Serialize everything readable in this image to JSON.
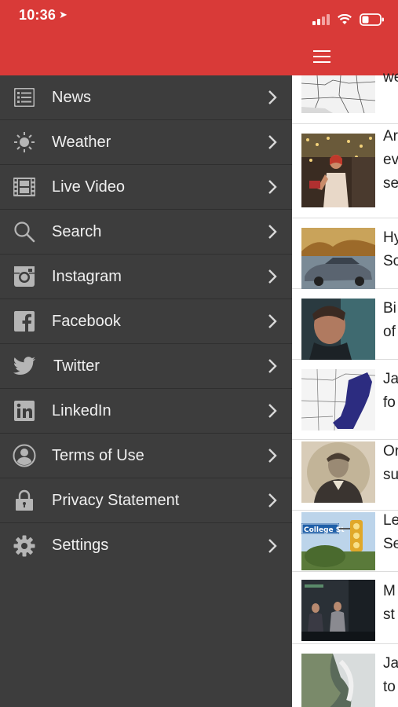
{
  "status": {
    "time": "10:36"
  },
  "menu": {
    "items": [
      {
        "label": "News",
        "icon": "list-icon"
      },
      {
        "label": "Weather",
        "icon": "sun-icon"
      },
      {
        "label": "Live Video",
        "icon": "film-icon"
      },
      {
        "label": "Search",
        "icon": "search-icon"
      },
      {
        "label": "Instagram",
        "icon": "instagram-icon"
      },
      {
        "label": "Facebook",
        "icon": "facebook-icon"
      },
      {
        "label": "Twitter",
        "icon": "twitter-icon"
      },
      {
        "label": "LinkedIn",
        "icon": "linkedin-icon"
      },
      {
        "label": "Terms of Use",
        "icon": "person-icon"
      },
      {
        "label": "Privacy Statement",
        "icon": "lock-icon"
      },
      {
        "label": "Settings",
        "icon": "gear-icon"
      }
    ]
  },
  "feed": {
    "items": [
      {
        "line1": "",
        "line2": "we"
      },
      {
        "line1": "Ar",
        "line2": "ev",
        "line3": "se"
      },
      {
        "line1": "Hy",
        "line2": "Sc"
      },
      {
        "line1": "Bi",
        "line2": "of"
      },
      {
        "line1": "Ja",
        "line2": "fo"
      },
      {
        "line1": "Or",
        "line2": "su"
      },
      {
        "line1": "Le",
        "line2": "Se"
      },
      {
        "line1": "M",
        "line2": "st"
      },
      {
        "line1": "Ja",
        "line2": "to"
      }
    ],
    "sign_text": "College St"
  },
  "colors": {
    "header_red": "#d93a38",
    "drawer_bg": "#3d3d3d",
    "icon_gray": "#b5b5b5",
    "battery_red": "#e84545"
  }
}
